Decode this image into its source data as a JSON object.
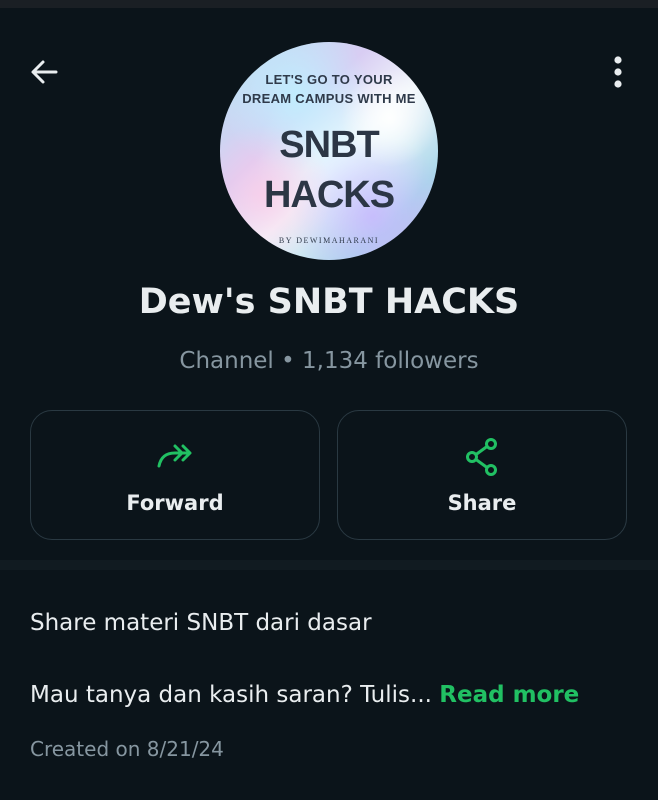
{
  "avatar": {
    "tagline_line1": "LET'S GO TO YOUR",
    "tagline_line2": "DREAM CAMPUS WITH ME",
    "title_line1": "SNBT",
    "title_line2": "HACKS",
    "byline": "BY DEWIMAHARANI"
  },
  "channel": {
    "name": "Dew's SNBT HACKS",
    "meta": "Channel • 1,134 followers"
  },
  "actions": {
    "forward_label": "Forward",
    "share_label": "Share"
  },
  "description": {
    "line1": "Share materi SNBT dari dasar",
    "line2": "Mau tanya dan kasih saran? Tulis...",
    "read_more": "Read more",
    "created": "Created on 8/21/24"
  },
  "icons": {
    "back": "arrow-left-icon",
    "menu": "more-vertical-icon",
    "forward": "forward-icon",
    "share": "share-icon"
  },
  "colors": {
    "background": "#0b141a",
    "accent": "#21c063",
    "text_primary": "#e9edef",
    "text_secondary": "#8696a0"
  }
}
